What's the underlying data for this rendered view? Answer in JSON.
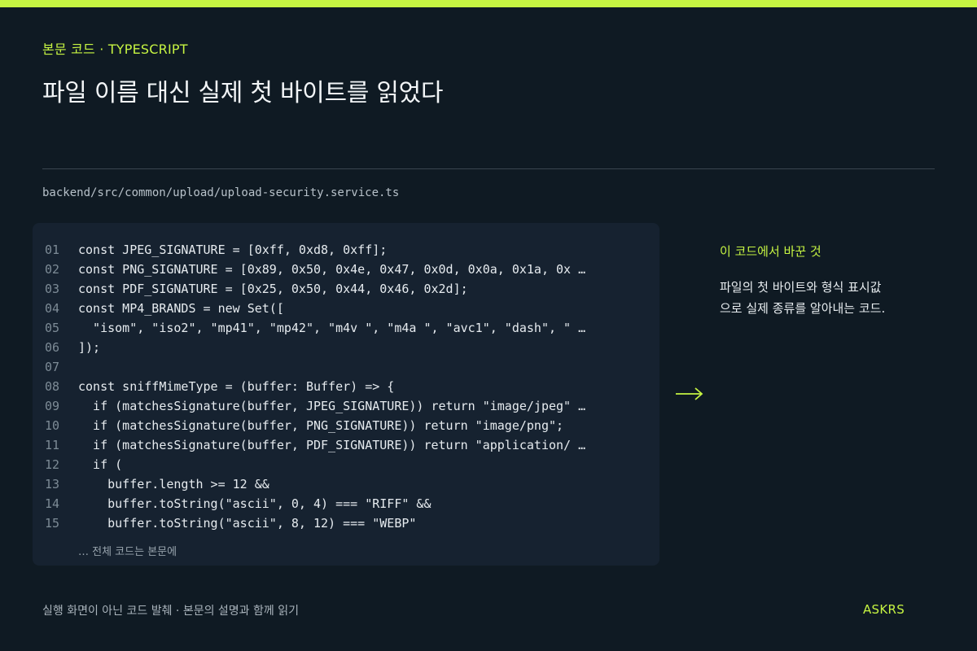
{
  "header": {
    "eyebrow": "본문 코드 · TYPESCRIPT",
    "title": "파일 이름 대신 실제 첫 바이트를 읽었다"
  },
  "file_path": "backend/src/common/upload/upload-security.service.ts",
  "code": {
    "lines": [
      {
        "num": "01",
        "text": "const JPEG_SIGNATURE = [0xff, 0xd8, 0xff];"
      },
      {
        "num": "02",
        "text": "const PNG_SIGNATURE = [0x89, 0x50, 0x4e, 0x47, 0x0d, 0x0a, 0x1a, 0x …"
      },
      {
        "num": "03",
        "text": "const PDF_SIGNATURE = [0x25, 0x50, 0x44, 0x46, 0x2d];"
      },
      {
        "num": "04",
        "text": "const MP4_BRANDS = new Set(["
      },
      {
        "num": "05",
        "text": "  \"isom\", \"iso2\", \"mp41\", \"mp42\", \"m4v \", \"m4a \", \"avc1\", \"dash\", \" …"
      },
      {
        "num": "06",
        "text": "]);"
      },
      {
        "num": "07",
        "text": ""
      },
      {
        "num": "08",
        "text": "const sniffMimeType = (buffer: Buffer) => {"
      },
      {
        "num": "09",
        "text": "  if (matchesSignature(buffer, JPEG_SIGNATURE)) return \"image/jpeg\" …"
      },
      {
        "num": "10",
        "text": "  if (matchesSignature(buffer, PNG_SIGNATURE)) return \"image/png\";"
      },
      {
        "num": "11",
        "text": "  if (matchesSignature(buffer, PDF_SIGNATURE)) return \"application/ …"
      },
      {
        "num": "12",
        "text": "  if ("
      },
      {
        "num": "13",
        "text": "    buffer.length >= 12 &&"
      },
      {
        "num": "14",
        "text": "    buffer.toString(\"ascii\", 0, 4) === \"RIFF\" &&"
      },
      {
        "num": "15",
        "text": "    buffer.toString(\"ascii\", 8, 12) === \"WEBP\""
      }
    ],
    "more_note": "… 전체 코드는 본문에"
  },
  "side": {
    "arrow_icon": "arrow-right-icon",
    "title": "이 코드에서 바꾼 것",
    "body": "파일의 첫 바이트와 형식 표시값으로 실제 종류를 알아내는 코드."
  },
  "footer": {
    "note": "실행 화면이 아닌 코드 발췌 · 본문의 설명과 함께 읽기",
    "brand": "ASKRS"
  },
  "colors": {
    "accent": "#c6f442",
    "background": "#0f1a23",
    "code_panel": "#162230"
  }
}
